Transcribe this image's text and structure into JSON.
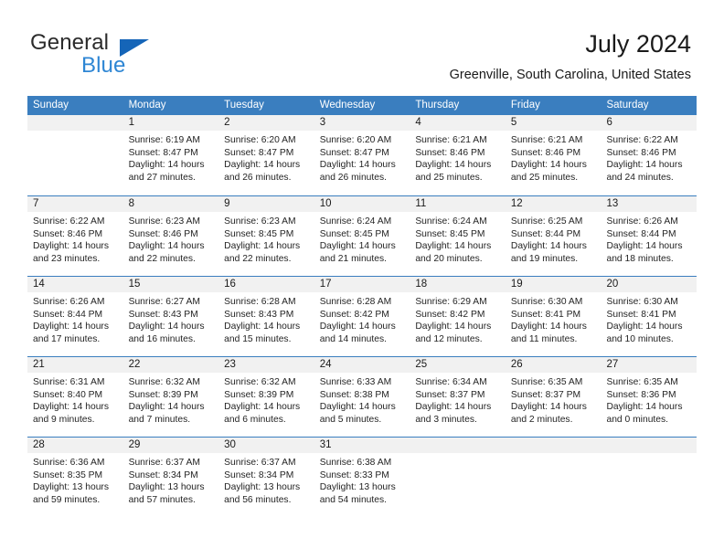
{
  "brand": {
    "name_part1": "General",
    "name_part2": "Blue",
    "color_primary": "#2e86d4",
    "color_triangle": "#1565b8"
  },
  "header": {
    "title": "July 2024",
    "subtitle": "Greenville, South Carolina, United States"
  },
  "calendar": {
    "header_bg": "#3a7ebf",
    "daynum_bg": "#f1f1f1",
    "weekday_labels": [
      "Sunday",
      "Monday",
      "Tuesday",
      "Wednesday",
      "Thursday",
      "Friday",
      "Saturday"
    ],
    "weeks": [
      [
        {
          "day": "",
          "sunrise": "",
          "sunset": "",
          "daylight1": "",
          "daylight2": ""
        },
        {
          "day": "1",
          "sunrise": "Sunrise: 6:19 AM",
          "sunset": "Sunset: 8:47 PM",
          "daylight1": "Daylight: 14 hours",
          "daylight2": "and 27 minutes."
        },
        {
          "day": "2",
          "sunrise": "Sunrise: 6:20 AM",
          "sunset": "Sunset: 8:47 PM",
          "daylight1": "Daylight: 14 hours",
          "daylight2": "and 26 minutes."
        },
        {
          "day": "3",
          "sunrise": "Sunrise: 6:20 AM",
          "sunset": "Sunset: 8:47 PM",
          "daylight1": "Daylight: 14 hours",
          "daylight2": "and 26 minutes."
        },
        {
          "day": "4",
          "sunrise": "Sunrise: 6:21 AM",
          "sunset": "Sunset: 8:46 PM",
          "daylight1": "Daylight: 14 hours",
          "daylight2": "and 25 minutes."
        },
        {
          "day": "5",
          "sunrise": "Sunrise: 6:21 AM",
          "sunset": "Sunset: 8:46 PM",
          "daylight1": "Daylight: 14 hours",
          "daylight2": "and 25 minutes."
        },
        {
          "day": "6",
          "sunrise": "Sunrise: 6:22 AM",
          "sunset": "Sunset: 8:46 PM",
          "daylight1": "Daylight: 14 hours",
          "daylight2": "and 24 minutes."
        }
      ],
      [
        {
          "day": "7",
          "sunrise": "Sunrise: 6:22 AM",
          "sunset": "Sunset: 8:46 PM",
          "daylight1": "Daylight: 14 hours",
          "daylight2": "and 23 minutes."
        },
        {
          "day": "8",
          "sunrise": "Sunrise: 6:23 AM",
          "sunset": "Sunset: 8:46 PM",
          "daylight1": "Daylight: 14 hours",
          "daylight2": "and 22 minutes."
        },
        {
          "day": "9",
          "sunrise": "Sunrise: 6:23 AM",
          "sunset": "Sunset: 8:45 PM",
          "daylight1": "Daylight: 14 hours",
          "daylight2": "and 22 minutes."
        },
        {
          "day": "10",
          "sunrise": "Sunrise: 6:24 AM",
          "sunset": "Sunset: 8:45 PM",
          "daylight1": "Daylight: 14 hours",
          "daylight2": "and 21 minutes."
        },
        {
          "day": "11",
          "sunrise": "Sunrise: 6:24 AM",
          "sunset": "Sunset: 8:45 PM",
          "daylight1": "Daylight: 14 hours",
          "daylight2": "and 20 minutes."
        },
        {
          "day": "12",
          "sunrise": "Sunrise: 6:25 AM",
          "sunset": "Sunset: 8:44 PM",
          "daylight1": "Daylight: 14 hours",
          "daylight2": "and 19 minutes."
        },
        {
          "day": "13",
          "sunrise": "Sunrise: 6:26 AM",
          "sunset": "Sunset: 8:44 PM",
          "daylight1": "Daylight: 14 hours",
          "daylight2": "and 18 minutes."
        }
      ],
      [
        {
          "day": "14",
          "sunrise": "Sunrise: 6:26 AM",
          "sunset": "Sunset: 8:44 PM",
          "daylight1": "Daylight: 14 hours",
          "daylight2": "and 17 minutes."
        },
        {
          "day": "15",
          "sunrise": "Sunrise: 6:27 AM",
          "sunset": "Sunset: 8:43 PM",
          "daylight1": "Daylight: 14 hours",
          "daylight2": "and 16 minutes."
        },
        {
          "day": "16",
          "sunrise": "Sunrise: 6:28 AM",
          "sunset": "Sunset: 8:43 PM",
          "daylight1": "Daylight: 14 hours",
          "daylight2": "and 15 minutes."
        },
        {
          "day": "17",
          "sunrise": "Sunrise: 6:28 AM",
          "sunset": "Sunset: 8:42 PM",
          "daylight1": "Daylight: 14 hours",
          "daylight2": "and 14 minutes."
        },
        {
          "day": "18",
          "sunrise": "Sunrise: 6:29 AM",
          "sunset": "Sunset: 8:42 PM",
          "daylight1": "Daylight: 14 hours",
          "daylight2": "and 12 minutes."
        },
        {
          "day": "19",
          "sunrise": "Sunrise: 6:30 AM",
          "sunset": "Sunset: 8:41 PM",
          "daylight1": "Daylight: 14 hours",
          "daylight2": "and 11 minutes."
        },
        {
          "day": "20",
          "sunrise": "Sunrise: 6:30 AM",
          "sunset": "Sunset: 8:41 PM",
          "daylight1": "Daylight: 14 hours",
          "daylight2": "and 10 minutes."
        }
      ],
      [
        {
          "day": "21",
          "sunrise": "Sunrise: 6:31 AM",
          "sunset": "Sunset: 8:40 PM",
          "daylight1": "Daylight: 14 hours",
          "daylight2": "and 9 minutes."
        },
        {
          "day": "22",
          "sunrise": "Sunrise: 6:32 AM",
          "sunset": "Sunset: 8:39 PM",
          "daylight1": "Daylight: 14 hours",
          "daylight2": "and 7 minutes."
        },
        {
          "day": "23",
          "sunrise": "Sunrise: 6:32 AM",
          "sunset": "Sunset: 8:39 PM",
          "daylight1": "Daylight: 14 hours",
          "daylight2": "and 6 minutes."
        },
        {
          "day": "24",
          "sunrise": "Sunrise: 6:33 AM",
          "sunset": "Sunset: 8:38 PM",
          "daylight1": "Daylight: 14 hours",
          "daylight2": "and 5 minutes."
        },
        {
          "day": "25",
          "sunrise": "Sunrise: 6:34 AM",
          "sunset": "Sunset: 8:37 PM",
          "daylight1": "Daylight: 14 hours",
          "daylight2": "and 3 minutes."
        },
        {
          "day": "26",
          "sunrise": "Sunrise: 6:35 AM",
          "sunset": "Sunset: 8:37 PM",
          "daylight1": "Daylight: 14 hours",
          "daylight2": "and 2 minutes."
        },
        {
          "day": "27",
          "sunrise": "Sunrise: 6:35 AM",
          "sunset": "Sunset: 8:36 PM",
          "daylight1": "Daylight: 14 hours",
          "daylight2": "and 0 minutes."
        }
      ],
      [
        {
          "day": "28",
          "sunrise": "Sunrise: 6:36 AM",
          "sunset": "Sunset: 8:35 PM",
          "daylight1": "Daylight: 13 hours",
          "daylight2": "and 59 minutes."
        },
        {
          "day": "29",
          "sunrise": "Sunrise: 6:37 AM",
          "sunset": "Sunset: 8:34 PM",
          "daylight1": "Daylight: 13 hours",
          "daylight2": "and 57 minutes."
        },
        {
          "day": "30",
          "sunrise": "Sunrise: 6:37 AM",
          "sunset": "Sunset: 8:34 PM",
          "daylight1": "Daylight: 13 hours",
          "daylight2": "and 56 minutes."
        },
        {
          "day": "31",
          "sunrise": "Sunrise: 6:38 AM",
          "sunset": "Sunset: 8:33 PM",
          "daylight1": "Daylight: 13 hours",
          "daylight2": "and 54 minutes."
        },
        {
          "day": "",
          "sunrise": "",
          "sunset": "",
          "daylight1": "",
          "daylight2": ""
        },
        {
          "day": "",
          "sunrise": "",
          "sunset": "",
          "daylight1": "",
          "daylight2": ""
        },
        {
          "day": "",
          "sunrise": "",
          "sunset": "",
          "daylight1": "",
          "daylight2": ""
        }
      ]
    ]
  }
}
